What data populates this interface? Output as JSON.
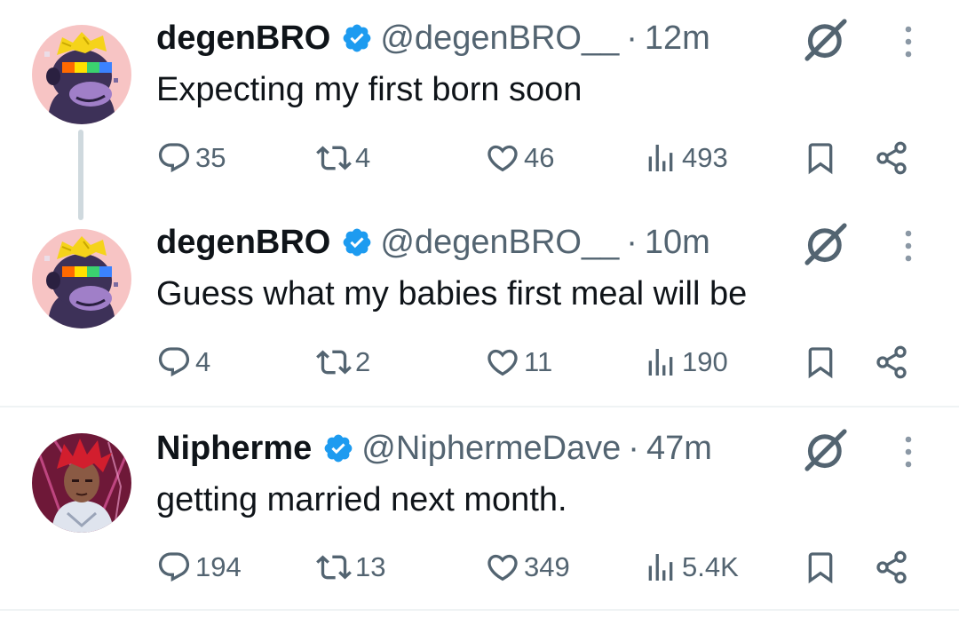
{
  "tweets": [
    {
      "name": "degenBRO",
      "handle": "@degenBRO__",
      "time": "12m",
      "text": "Expecting my first born soon",
      "replies": "35",
      "reposts": "4",
      "likes": "46",
      "views": "493",
      "avatar_icon": "pixel-ape-avatar"
    },
    {
      "name": "degenBRO",
      "handle": "@degenBRO__",
      "time": "10m",
      "text": "Guess what my babies first meal will be",
      "replies": "4",
      "reposts": "2",
      "likes": "11",
      "views": "190",
      "avatar_icon": "pixel-ape-avatar"
    },
    {
      "name": "Nipherme",
      "handle": "@NiphermeDave",
      "time": "47m",
      "text": "getting married next month.",
      "replies": "194",
      "reposts": "13",
      "likes": "349",
      "views": "5.4K",
      "avatar_icon": "anime-character-avatar"
    }
  ],
  "separator": "·",
  "colors": {
    "verified": "#1d9bf0",
    "secondary_text": "#536471",
    "primary_text": "#0f1419",
    "thread_line": "#cfd9de"
  }
}
